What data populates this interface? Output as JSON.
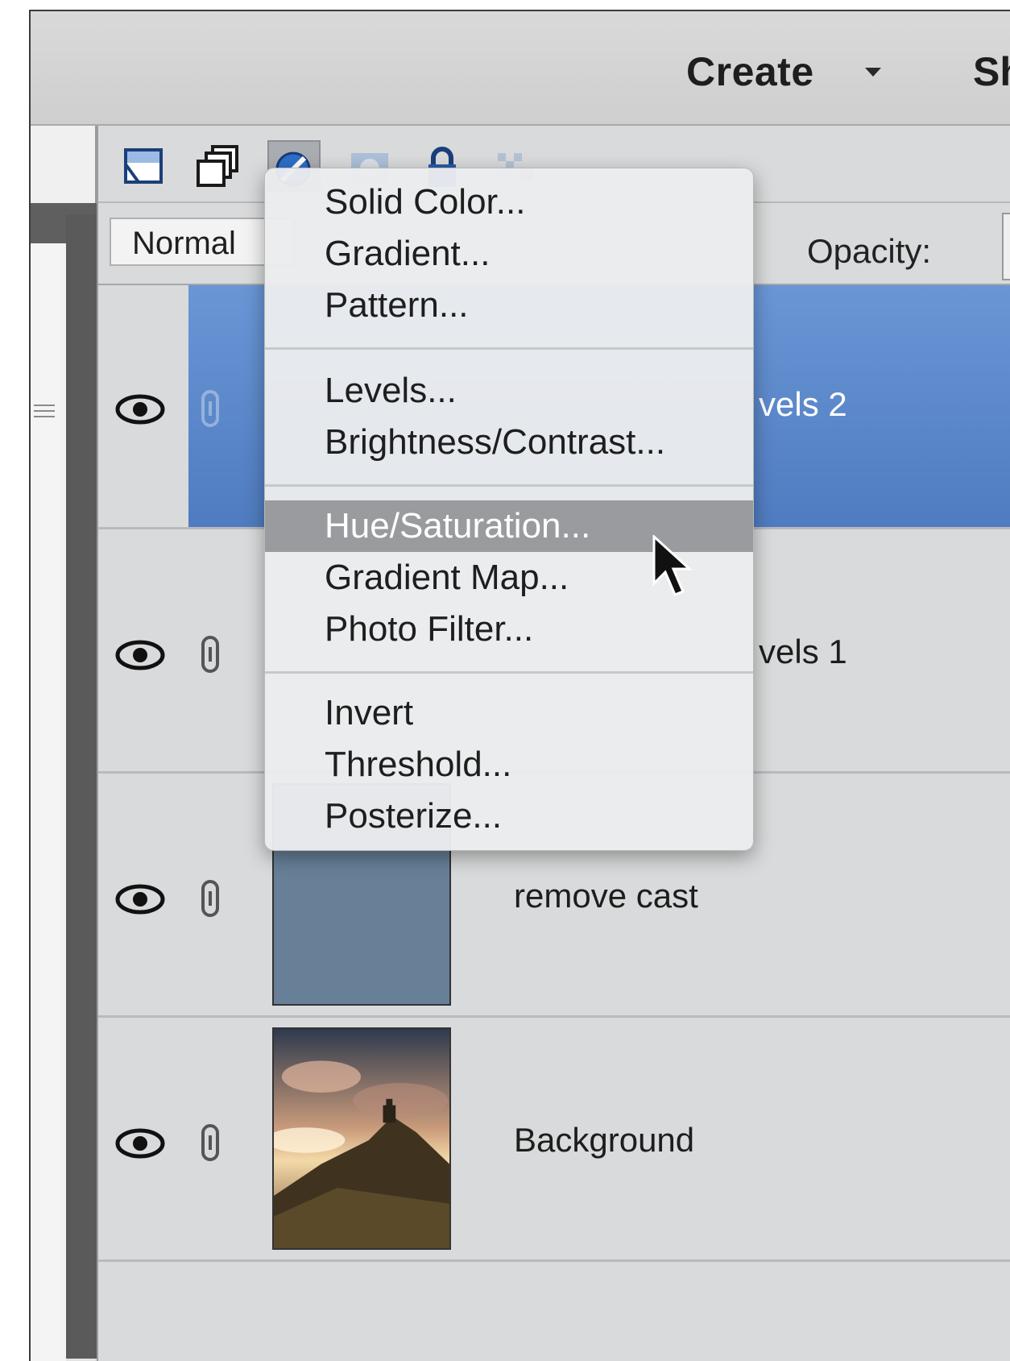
{
  "header": {
    "create_label": "Create",
    "share_label": "Sh"
  },
  "toolbar": {
    "icons": [
      "new-layer-icon",
      "new-group-icon",
      "new-fill-adjustment-layer-icon",
      "add-layer-mask-icon",
      "lock-all-icon",
      "lock-transparent-icon"
    ]
  },
  "options": {
    "blend_mode": "Normal",
    "opacity_label": "Opacity:"
  },
  "layers": [
    {
      "name": "Levels 2",
      "visible_name": "vels 2",
      "selected": true
    },
    {
      "name": "Levels 1",
      "visible_name": "vels 1",
      "selected": false
    },
    {
      "name": "remove cast",
      "visible_name": "remove cast",
      "selected": false
    },
    {
      "name": "Background",
      "visible_name": "Background",
      "selected": false
    }
  ],
  "menu": {
    "groups": [
      [
        "Solid Color...",
        "Gradient...",
        "Pattern..."
      ],
      [
        "Levels...",
        "Brightness/Contrast..."
      ],
      [
        "Hue/Saturation...",
        "Gradient Map...",
        "Photo Filter..."
      ],
      [
        "Invert",
        "Threshold...",
        "Posterize..."
      ]
    ],
    "highlighted": "Hue/Saturation..."
  },
  "colors": {
    "selected_layer": "#5b88cb",
    "menu_highlight": "#9a9b9e",
    "remove_cast_fill": "#677f97"
  }
}
